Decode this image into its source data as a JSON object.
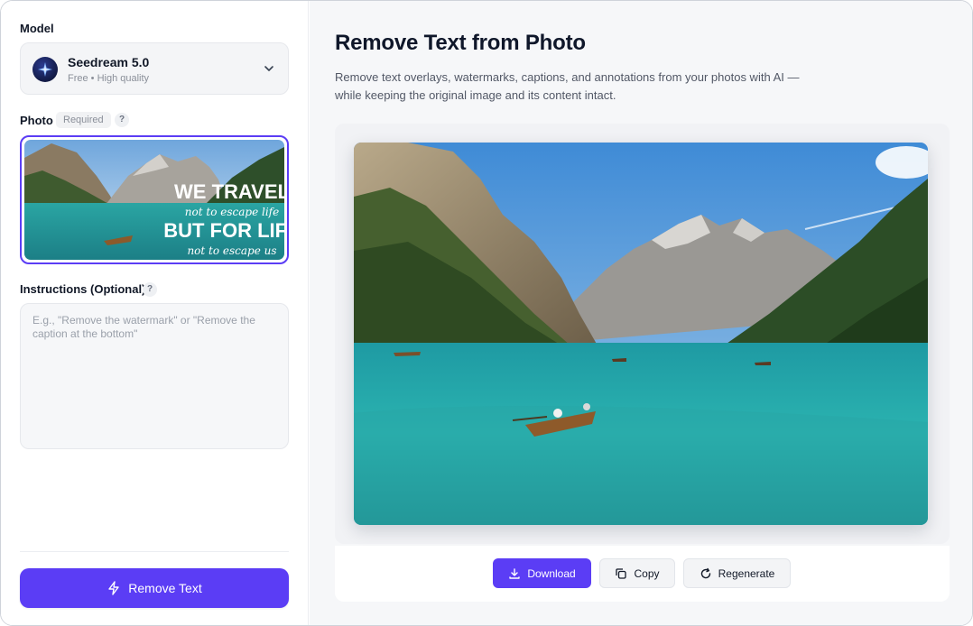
{
  "sidebar": {
    "model_label": "Model",
    "model": {
      "name": "Seedream 5.0",
      "subtitle": "Free • High quality",
      "icon": "seedream-logo-icon"
    },
    "photo_label": "Photo",
    "required_badge": "Required",
    "help_glyph": "?",
    "photo_overlay": {
      "line1": "WE TRAVEL",
      "line2": "not to escape life",
      "line3": "BUT FOR LIFE",
      "line4": "not to escape us"
    },
    "instructions_label": "Instructions (Optional)",
    "instructions_placeholder": "E.g., \"Remove the watermark\" or \"Remove the caption at the bottom\"",
    "instructions_value": "",
    "remove_button": "Remove Text"
  },
  "main": {
    "title": "Remove Text from Photo",
    "description": "Remove text overlays, watermarks, captions, and annotations from your photos with AI — while keeping the original image and its content intact.",
    "actions": {
      "download": "Download",
      "copy": "Copy",
      "regenerate": "Regenerate"
    }
  },
  "colors": {
    "accent": "#5b3df5",
    "main_bg": "#f6f7f9"
  }
}
